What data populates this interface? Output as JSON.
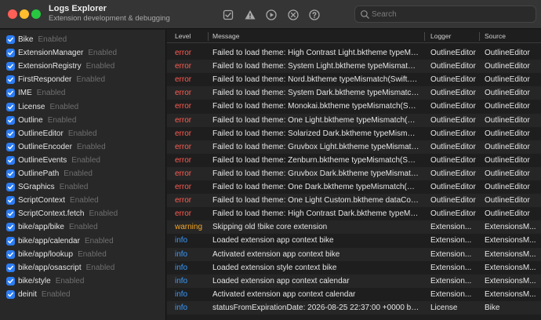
{
  "window": {
    "title": "Logs Explorer",
    "subtitle": "Extension development & debugging"
  },
  "toolbar": {
    "icons": [
      "checkbox-icon",
      "warning-icon",
      "play-icon",
      "clear-icon",
      "help-icon"
    ]
  },
  "search": {
    "placeholder": "Search",
    "value": ""
  },
  "sidebar": {
    "items": [
      {
        "name": "Bike",
        "state": "Enabled",
        "checked": true
      },
      {
        "name": "ExtensionManager",
        "state": "Enabled",
        "checked": true
      },
      {
        "name": "ExtensionRegistry",
        "state": "Enabled",
        "checked": true
      },
      {
        "name": "FirstResponder",
        "state": "Enabled",
        "checked": true
      },
      {
        "name": "IME",
        "state": "Enabled",
        "checked": true
      },
      {
        "name": "License",
        "state": "Enabled",
        "checked": true
      },
      {
        "name": "Outline",
        "state": "Enabled",
        "checked": true
      },
      {
        "name": "OutlineEditor",
        "state": "Enabled",
        "checked": true
      },
      {
        "name": "OutlineEncoder",
        "state": "Enabled",
        "checked": true
      },
      {
        "name": "OutlineEvents",
        "state": "Enabled",
        "checked": true
      },
      {
        "name": "OutlinePath",
        "state": "Enabled",
        "checked": true
      },
      {
        "name": "SGraphics",
        "state": "Enabled",
        "checked": true
      },
      {
        "name": "ScriptContext",
        "state": "Enabled",
        "checked": true
      },
      {
        "name": "ScriptContext.fetch",
        "state": "Enabled",
        "checked": true
      },
      {
        "name": "bike/app/bike",
        "state": "Enabled",
        "checked": true
      },
      {
        "name": "bike/app/calendar",
        "state": "Enabled",
        "checked": true
      },
      {
        "name": "bike/app/lookup",
        "state": "Enabled",
        "checked": true
      },
      {
        "name": "bike/app/osascript",
        "state": "Enabled",
        "checked": true
      },
      {
        "name": "bike/style",
        "state": "Enabled",
        "checked": true
      },
      {
        "name": "deinit",
        "state": "Enabled",
        "checked": true
      }
    ]
  },
  "table": {
    "columns": [
      "Level",
      "Message",
      "Logger",
      "Source"
    ],
    "rows": [
      {
        "level": "error",
        "message": "Failed to load theme: High Contrast Light.bktheme typeMismatch...",
        "logger": "OutlineEditor",
        "source": "OutlineEditor"
      },
      {
        "level": "error",
        "message": "Failed to load theme: System Light.bktheme typeMismatch(Swift....",
        "logger": "OutlineEditor",
        "source": "OutlineEditor"
      },
      {
        "level": "error",
        "message": "Failed to load theme: Nord.bktheme typeMismatch(Swift.Di...",
        "logger": "OutlineEditor",
        "source": "OutlineEditor"
      },
      {
        "level": "error",
        "message": "Failed to load theme: System Dark.bktheme typeMismatch(Swift....",
        "logger": "OutlineEditor",
        "source": "OutlineEditor"
      },
      {
        "level": "error",
        "message": "Failed to load theme: Monokai.bktheme typeMismatch(Swif...",
        "logger": "OutlineEditor",
        "source": "OutlineEditor"
      },
      {
        "level": "error",
        "message": "Failed to load theme: One Light.bktheme typeMismatch(Swit...",
        "logger": "OutlineEditor",
        "source": "OutlineEditor"
      },
      {
        "level": "error",
        "message": "Failed to load theme: Solarized Dark.bktheme typeMismatc...",
        "logger": "OutlineEditor",
        "source": "OutlineEditor"
      },
      {
        "level": "error",
        "message": "Failed to load theme: Gruvbox Light.bktheme typeMismatch...",
        "logger": "OutlineEditor",
        "source": "OutlineEditor"
      },
      {
        "level": "error",
        "message": "Failed to load theme: Zenburn.bktheme typeMismatch(Swift....",
        "logger": "OutlineEditor",
        "source": "OutlineEditor"
      },
      {
        "level": "error",
        "message": "Failed to load theme: Gruvbox Dark.bktheme typeMismatch(...",
        "logger": "OutlineEditor",
        "source": "OutlineEditor"
      },
      {
        "level": "error",
        "message": "Failed to load theme: One Dark.bktheme typeMismatch(Swi...",
        "logger": "OutlineEditor",
        "source": "OutlineEditor"
      },
      {
        "level": "error",
        "message": "Failed to load theme: One Light Custom.bktheme dataCorru...",
        "logger": "OutlineEditor",
        "source": "OutlineEditor"
      },
      {
        "level": "error",
        "message": "Failed to load theme: High Contrast Dark.bktheme typeMis...",
        "logger": "OutlineEditor",
        "source": "OutlineEditor"
      },
      {
        "level": "warning",
        "message": "Skipping old !bike core extension",
        "logger": "Extension...",
        "source": "ExtensionsM..."
      },
      {
        "level": "info",
        "message": "Loaded extension app context bike",
        "logger": "Extension...",
        "source": "ExtensionsM..."
      },
      {
        "level": "info",
        "message": "Activated extension app context bike",
        "logger": "Extension...",
        "source": "ExtensionsM..."
      },
      {
        "level": "info",
        "message": "Loaded extension style context bike",
        "logger": "Extension...",
        "source": "ExtensionsM..."
      },
      {
        "level": "info",
        "message": "Loaded extension app context calendar",
        "logger": "Extension...",
        "source": "ExtensionsM..."
      },
      {
        "level": "info",
        "message": "Activated extension app context calendar",
        "logger": "Extension...",
        "source": "ExtensionsM..."
      },
      {
        "level": "info",
        "message": "statusFromExpirationDate: 2026-08-25 22:37:00 +0000 bu...",
        "logger": "License",
        "source": "Bike"
      }
    ]
  },
  "colors": {
    "error": "#ff5c52",
    "warning": "#f5a623",
    "info": "#3a9bff",
    "accent": "#2b7df6"
  }
}
